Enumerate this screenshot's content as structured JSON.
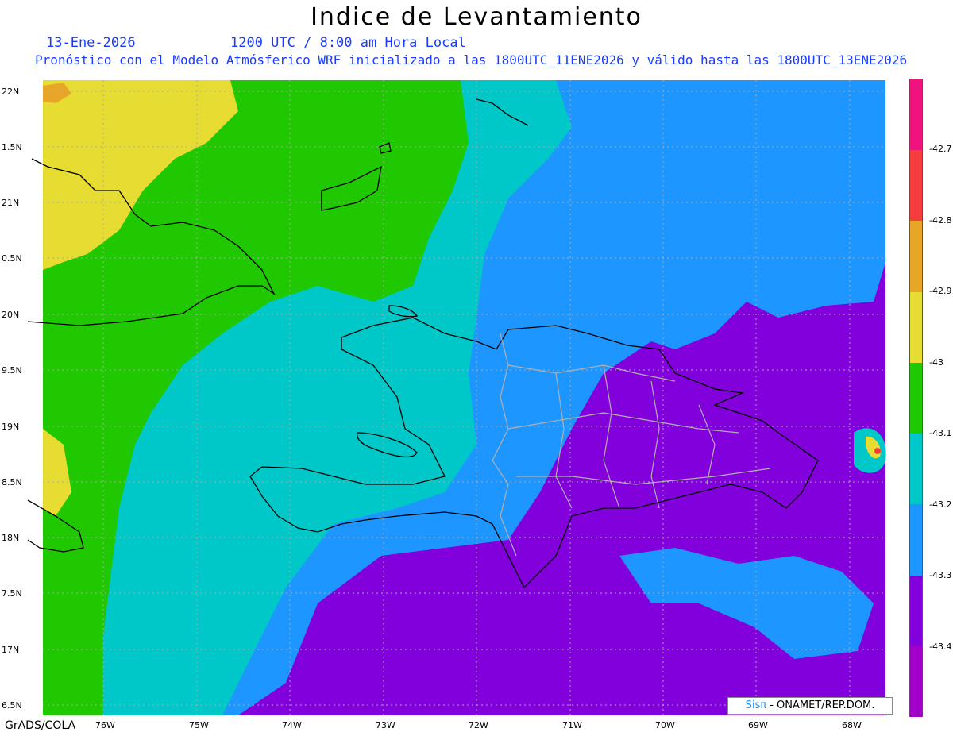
{
  "title": "Indice de Levantamiento",
  "date": "13-Ene-2026",
  "time": "1200 UTC / 8:00 am Hora Local",
  "model_line": "Pronóstico con el Modelo Atmósferico WRF inicializado a las 1800UTC_11ENE2026 y válido hasta las  1800UTC_13ENE2026",
  "lat_labels": [
    "22N",
    "1.5N",
    "21N",
    "0.5N",
    "20N",
    "9.5N",
    "19N",
    "8.5N",
    "18N",
    "7.5N",
    "17N",
    "6.5N"
  ],
  "lon_labels": [
    "76W",
    "75W",
    "74W",
    "73W",
    "72W",
    "71W",
    "70W",
    "69W",
    "68W"
  ],
  "colorbar": {
    "labels": [
      "-42.7",
      "-42.8",
      "-42.9",
      "-43",
      "-43.1",
      "-43.2",
      "-43.3",
      "-43.4"
    ],
    "colors": [
      "#f0127d",
      "#f53d3d",
      "#e8a628",
      "#e6dc32",
      "#1fc800",
      "#00c8c8",
      "#1e96ff",
      "#8200dc",
      "#a000c8"
    ]
  },
  "credit": {
    "brand": "Sisπ",
    "org": "- ONAMET/REP.DOM."
  },
  "footer": "GrADS/COLA"
}
